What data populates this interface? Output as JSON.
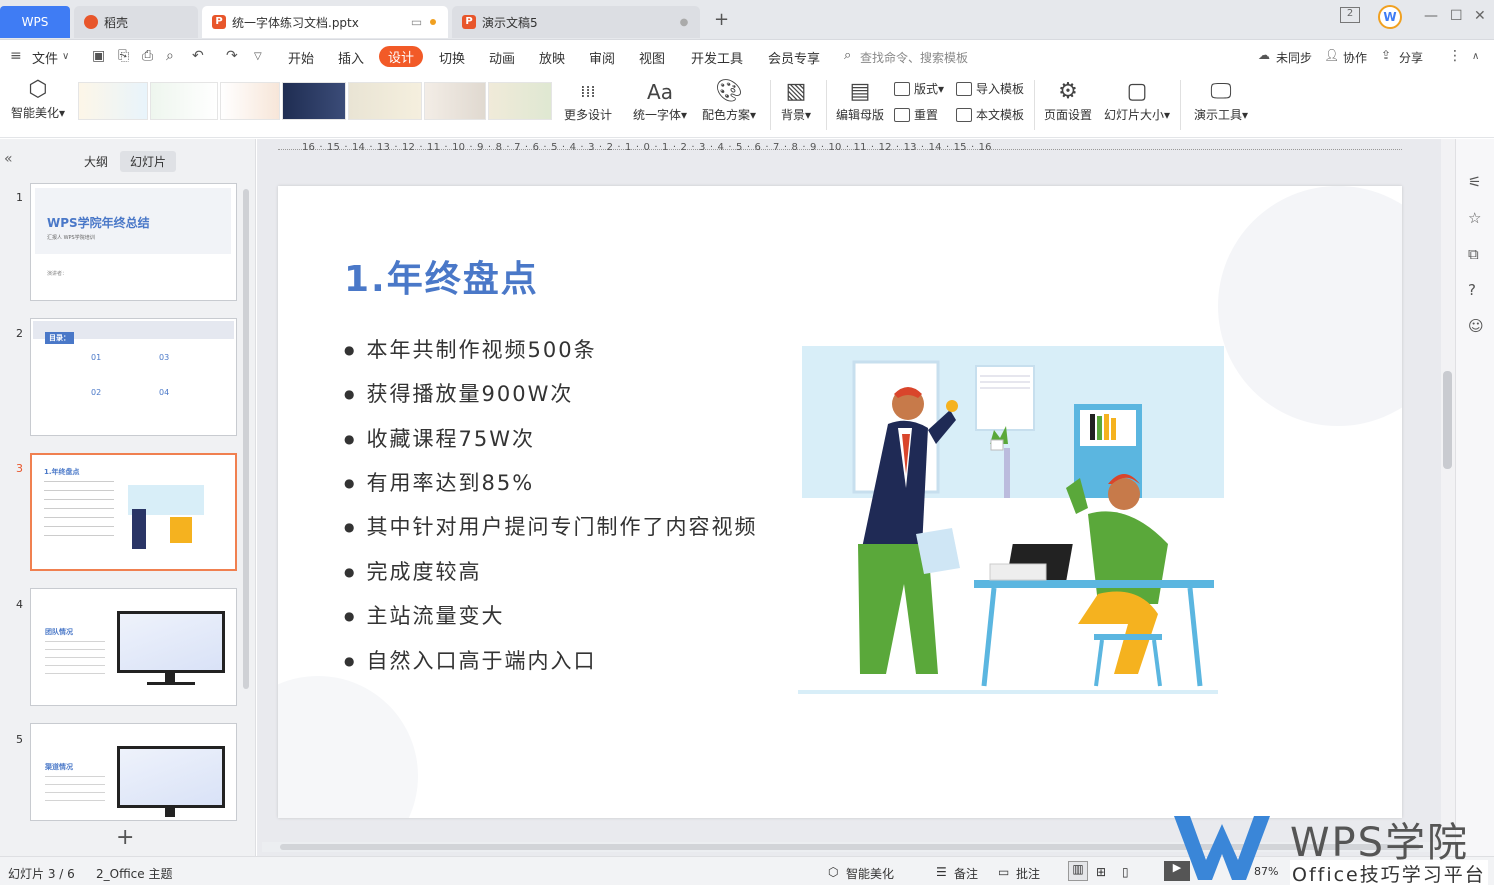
{
  "tabs": {
    "wps": "WPS",
    "docer": "稻壳",
    "active": "统一字体练习文档.pptx",
    "other": "演示文稿5",
    "new_tab": "+"
  },
  "menu": {
    "file": "文件",
    "items": [
      "开始",
      "插入",
      "设计",
      "切换",
      "动画",
      "放映",
      "审阅",
      "视图",
      "开发工具",
      "会员专享"
    ],
    "selected": "设计",
    "search_placeholder": "查找命令、搜索模板",
    "sync": "未同步",
    "collab": "协作",
    "share": "分享"
  },
  "ribbon": {
    "smart_beautify": "智能美化",
    "more_design": "更多设计",
    "unify_font": "统一字体",
    "color_scheme": "配色方案",
    "background": "背景",
    "edit_master": "编辑母版",
    "layout": "版式",
    "reset": "重置",
    "import_template": "导入模板",
    "this_template": "本文模板",
    "page_setup": "页面设置",
    "slide_size": "幻灯片大小",
    "presentation_tools": "演示工具"
  },
  "left_panel": {
    "outline_tab": "大纲",
    "slides_tab": "幻灯片",
    "add": "+",
    "slides": [
      {
        "num": "1",
        "title": "WPS学院年终总结",
        "sub": "汇报人 WPS学院培训",
        "extra": "演讲者："
      },
      {
        "num": "2",
        "title": "目录：",
        "items": [
          "01",
          "03",
          "02",
          "04"
        ]
      },
      {
        "num": "3",
        "title": "1.年终盘点"
      },
      {
        "num": "4",
        "title": "团队情况"
      },
      {
        "num": "5",
        "title": "渠道情况"
      }
    ]
  },
  "ruler": "16 · 15 · 14 · 13 · 12 · 11 · 10 · 9 · 8 · 7 · 6 · 5 · 4 · 3 · 2 · 1 · 0 · 1 · 2 · 3 · 4 · 5 · 6 · 7 · 8 · 9 · 10 · 11 · 12 · 13 · 14 · 15 · 16",
  "slide": {
    "title": "1.年终盘点",
    "bullets": [
      "本年共制作视频500条",
      "获得播放量900W次",
      "收藏课程75W次",
      "有用率达到85%",
      "其中针对用户提问专门制作了内容视频",
      "完成度较高",
      "主站流量变大",
      "自然入口高于端内入口"
    ]
  },
  "status": {
    "slide_info": "幻灯片 3 / 6",
    "theme": "2_Office 主题",
    "smart_beautify": "智能美化",
    "notes": "备注",
    "comments": "批注",
    "zoom": "87%"
  },
  "watermark": {
    "brand": "WPS学院",
    "tagline": "Office技巧学习平台"
  }
}
